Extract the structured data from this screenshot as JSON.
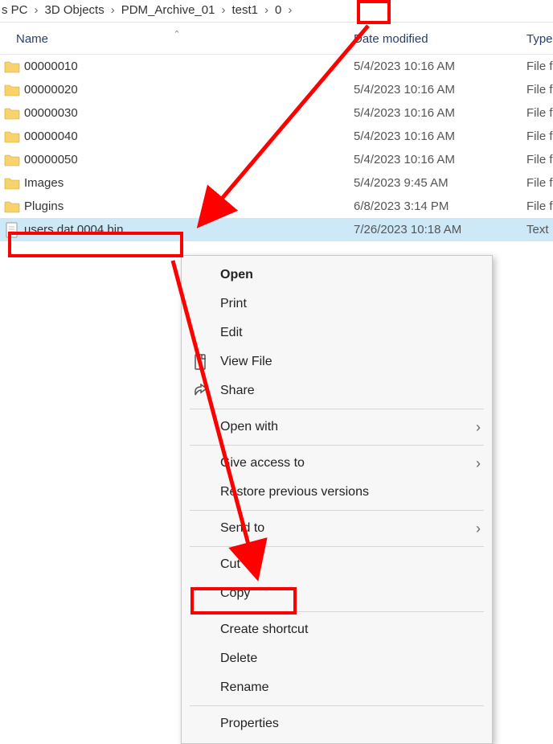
{
  "breadcrumb": {
    "items": [
      "s PC",
      "3D Objects",
      "PDM_Archive_01",
      "test1",
      "0"
    ]
  },
  "headers": {
    "name": "Name",
    "date": "Date modified",
    "type": "Type"
  },
  "rows": [
    {
      "icon": "folder",
      "name": "00000010",
      "date": "5/4/2023 10:16 AM",
      "type": "File f"
    },
    {
      "icon": "folder",
      "name": "00000020",
      "date": "5/4/2023 10:16 AM",
      "type": "File f"
    },
    {
      "icon": "folder",
      "name": "00000030",
      "date": "5/4/2023 10:16 AM",
      "type": "File f"
    },
    {
      "icon": "folder",
      "name": "00000040",
      "date": "5/4/2023 10:16 AM",
      "type": "File f"
    },
    {
      "icon": "folder",
      "name": "00000050",
      "date": "5/4/2023 10:16 AM",
      "type": "File f"
    },
    {
      "icon": "folder",
      "name": "Images",
      "date": "5/4/2023 9:45 AM",
      "type": "File f"
    },
    {
      "icon": "folder",
      "name": "Plugins",
      "date": "6/8/2023 3:14 PM",
      "type": "File f"
    },
    {
      "icon": "file",
      "name": "users.dat.0004.bin",
      "date": "7/26/2023 10:18 AM",
      "type": "Text",
      "selected": true
    }
  ],
  "menu": {
    "open": "Open",
    "print": "Print",
    "edit": "Edit",
    "viewfile": "View File",
    "share": "Share",
    "openwith": "Open with",
    "giveaccess": "Give access to",
    "restore": "Restore previous versions",
    "sendto": "Send to",
    "cut": "Cut",
    "copy": "Copy",
    "createshortcut": "Create shortcut",
    "delete": "Delete",
    "rename": "Rename",
    "properties": "Properties"
  },
  "annotations": {
    "highlight_breadcrumb_last": true,
    "highlight_selected_file": true,
    "highlight_delete": true
  }
}
